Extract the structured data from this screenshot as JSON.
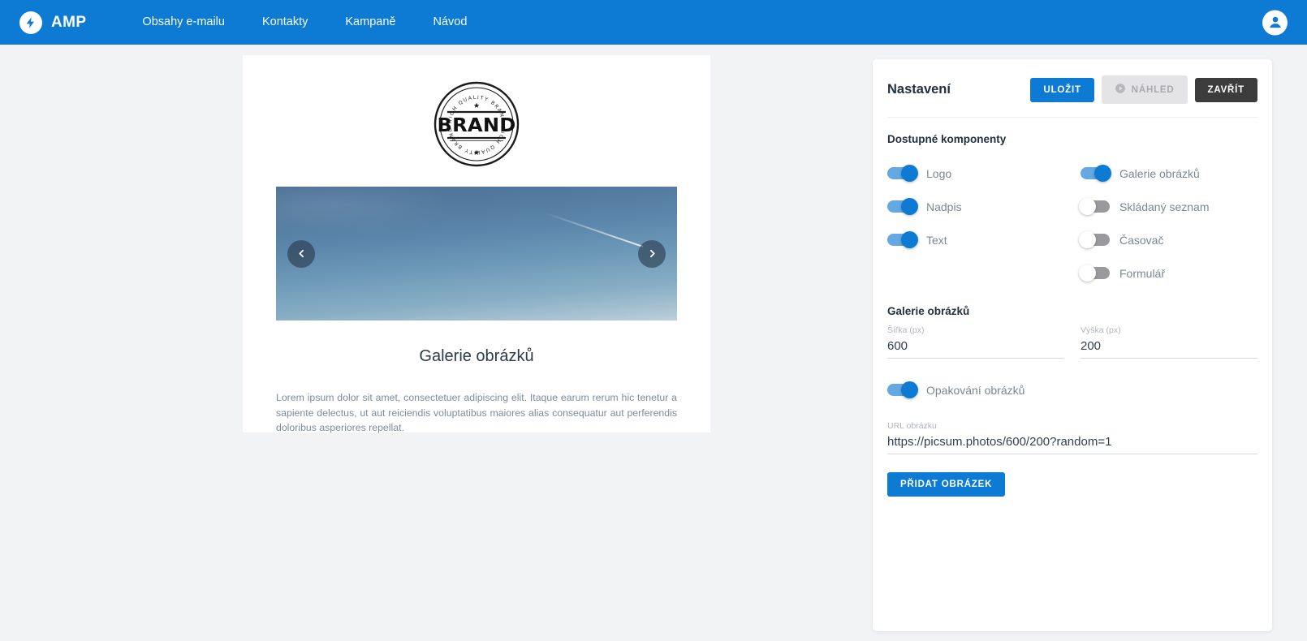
{
  "brand": {
    "name": "AMP",
    "logo_icon": "lightning-bolt-icon",
    "accent_color": "#0d7bd4"
  },
  "topnav": {
    "links": [
      {
        "label": "Obsahy e-mailu"
      },
      {
        "label": "Kontakty"
      },
      {
        "label": "Kampaně"
      },
      {
        "label": "Návod"
      }
    ],
    "account_icon": "account-circle-icon"
  },
  "preview": {
    "logo": {
      "center_text": "BRAND",
      "arc_top_text": "HIGH QUALITY BRAND",
      "arc_bottom_text": "HIGH QUALITY BRAND",
      "star_glyph": "★"
    },
    "carousel": {
      "prev_icon": "chevron-left-icon",
      "next_icon": "chevron-right-icon",
      "width_px": "600",
      "height_px": "200"
    },
    "heading": "Galerie obrázků",
    "body": "Lorem ipsum dolor sit amet, consectetuer adipiscing elit. Itaque earum rerum hic tenetur a sapiente delectus, ut aut reiciendis voluptatibus maiores alias consequatur aut perferendis doloribus asperiores repellat."
  },
  "settings": {
    "title": "Nastavení",
    "buttons": {
      "save": "ULOŽIT",
      "preview": "NÁHLED",
      "preview_icon": "play-circle-icon",
      "preview_disabled": true,
      "close": "ZAVŘÍT"
    },
    "components_section_title": "Dostupné komponenty",
    "components_left": [
      {
        "label": "Logo",
        "on": true
      },
      {
        "label": "Nadpis",
        "on": true
      },
      {
        "label": "Text",
        "on": true
      }
    ],
    "components_right": [
      {
        "label": "Galerie obrázků",
        "on": true
      },
      {
        "label": "Skládaný seznam",
        "on": false
      },
      {
        "label": "Časovač",
        "on": false
      },
      {
        "label": "Formulář",
        "on": false
      }
    ],
    "gallery": {
      "section_title": "Galerie obrázků",
      "width_label": "Šířka (px)",
      "width_value": "600",
      "height_label": "Výška (px)",
      "height_value": "200",
      "repeat_label": "Opakování obrázků",
      "repeat_on": true,
      "url_label": "URL obrázku",
      "url_value": "https://picsum.photos/600/200?random=1",
      "add_image_button": "PŘIDAT OBRÁZEK"
    }
  }
}
